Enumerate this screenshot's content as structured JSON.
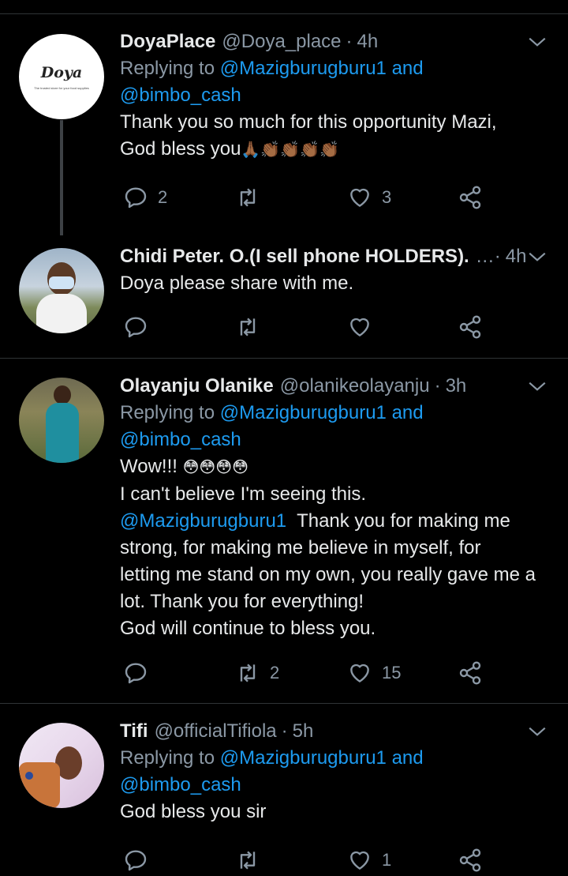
{
  "tweets": [
    {
      "name": "DoyaPlace",
      "handle": "@Doya_place",
      "time": "4h",
      "avatar_text": "Doya",
      "avatar_caption": "The trusted store for your food supplies",
      "replying_prefix": "Replying to",
      "reply_user1": "@Mazigburugburu1",
      "reply_and": "and",
      "reply_user2": "@bimbo_cash",
      "text_lines": [
        "Thank you so much for this opportunity Mazi,",
        "God bless you"
      ],
      "emojis": "🙏🏾👏🏾👏🏾👏🏾👏🏾",
      "reply_count": "2",
      "retweet_count": "",
      "like_count": "3"
    },
    {
      "name": "Chidi Peter. O.(I sell phone HOLDERS).",
      "handle": "…·",
      "time": "4h",
      "text_lines": [
        "Doya please share with me."
      ],
      "reply_count": "",
      "retweet_count": "",
      "like_count": ""
    },
    {
      "name": "Olayanju Olanike",
      "handle": "@olanikeolayanju",
      "time": "3h",
      "replying_prefix": "Replying to",
      "reply_user1": "@Mazigburugburu1",
      "reply_and": "and",
      "reply_user2": "@bimbo_cash",
      "first_line": "Wow!!!",
      "emojis": "😳😳😳😳",
      "line2": "I can't believe I'm seeing this.",
      "mention": "@Mazigburugburu1",
      "mention_rest": "Thank you for making me",
      "text_lines": [
        "strong, for making me believe in myself, for",
        "letting me stand on my own, you really gave me a",
        "lot. Thank you for everything!",
        "God will continue to bless you."
      ],
      "reply_count": "",
      "retweet_count": "2",
      "like_count": "15"
    },
    {
      "name": "Tifi",
      "handle": "@officialTifiola",
      "time": "5h",
      "replying_prefix": "Replying to",
      "reply_user1": "@Mazigburugburu1",
      "reply_and": "and",
      "reply_user2": "@bimbo_cash",
      "text_lines": [
        "God bless you sir"
      ],
      "reply_count": "",
      "retweet_count": "",
      "like_count": "1"
    }
  ],
  "colors": {
    "background": "#000000",
    "text": "#e7e9ea",
    "muted": "#8b98a5",
    "link": "#1d9bf0",
    "divider": "#2f3336"
  },
  "icons": [
    "reply-icon",
    "retweet-icon",
    "like-icon",
    "share-icon",
    "caret-down-icon"
  ]
}
